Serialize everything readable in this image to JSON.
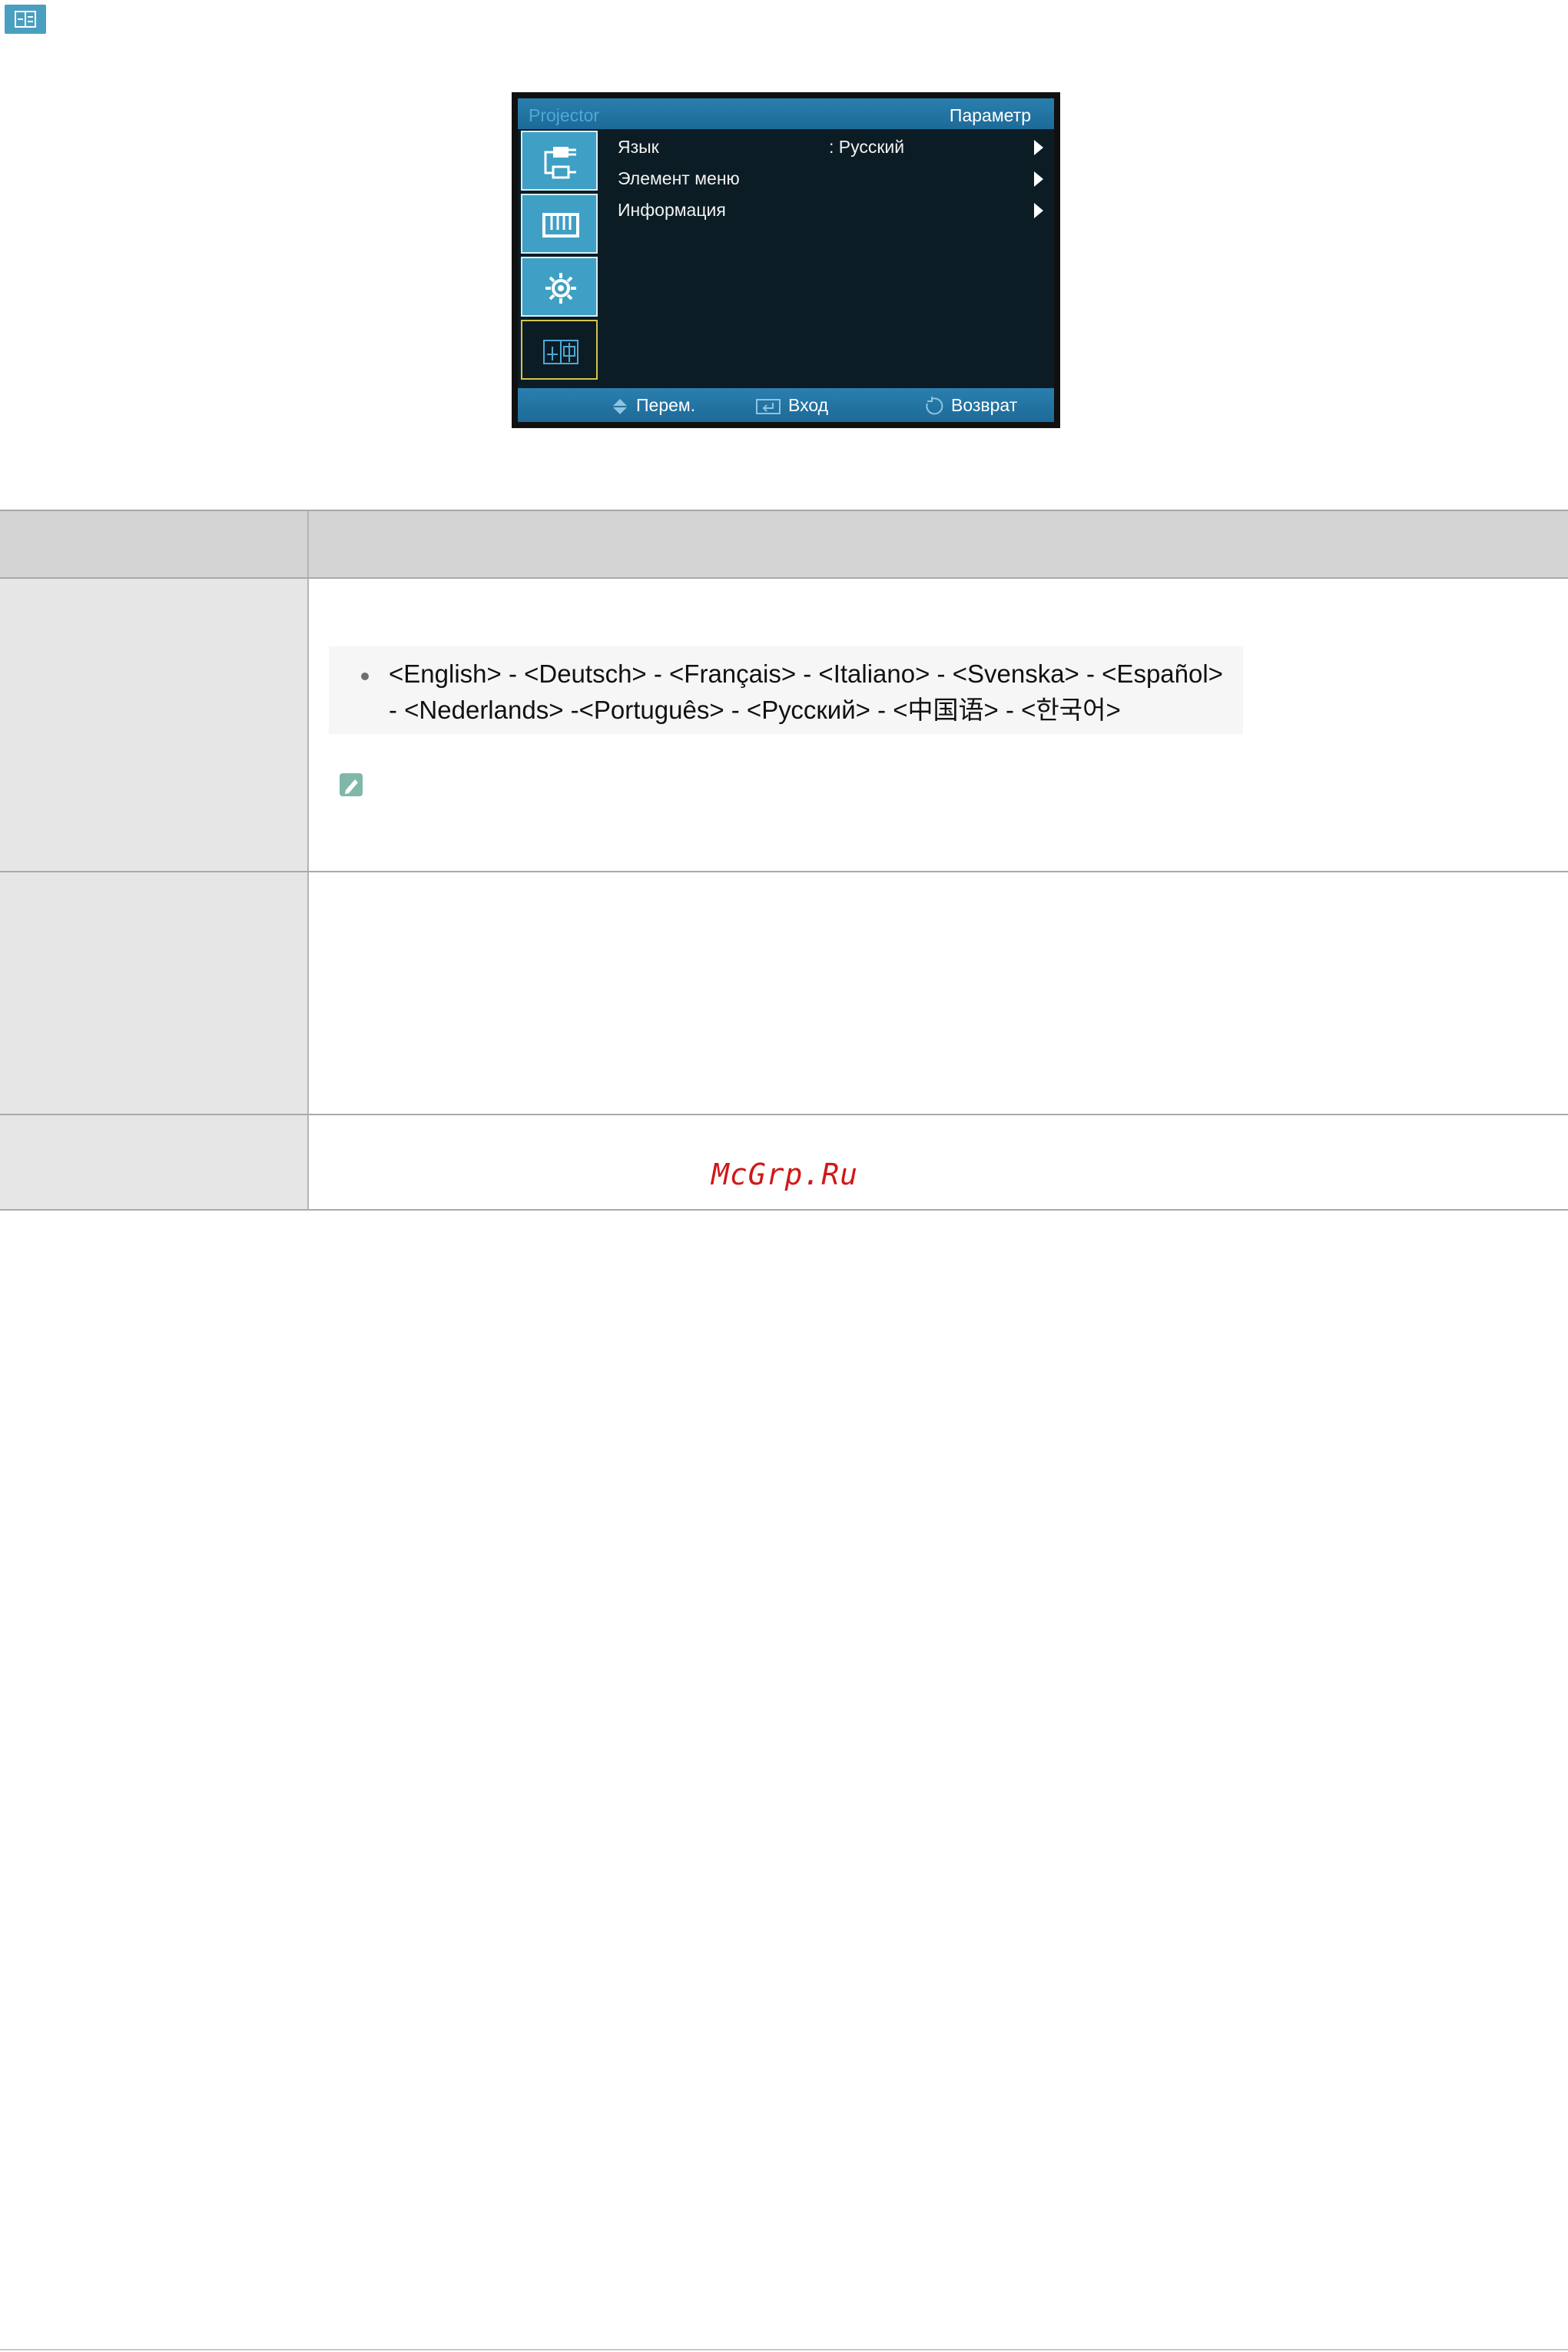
{
  "section_icon": "language-settings-icon",
  "osd": {
    "brand": "Projector",
    "title": "Параметр",
    "side_icons": [
      "input-source-icon",
      "picture-icon",
      "setup-gear-icon",
      "language-option-icon"
    ],
    "selected_tab": 3,
    "menu": [
      {
        "label": "Язык",
        "value": ": Русский"
      },
      {
        "label": "Элемент меню",
        "value": ""
      },
      {
        "label": "Информация",
        "value": ""
      }
    ],
    "footer": {
      "move_label": "Перем.",
      "enter_label": "Вход",
      "return_label": "Возврат"
    }
  },
  "languages": {
    "line1": "<English> - <Deutsch> - <Français> - <Italiano> - <Svenska> - <Español>",
    "line2": "- <Nederlands> -<Português> - <Русский>  -  <中国语>  -  <한국어>"
  },
  "note_icon": "note-pencil-icon",
  "watermark": "McGrp.Ru",
  "colors": {
    "osd_blue": "#2a7fae",
    "tile_blue": "#3f9fc4",
    "selected_border": "#d7c44a",
    "watermark_red": "#d01818"
  }
}
